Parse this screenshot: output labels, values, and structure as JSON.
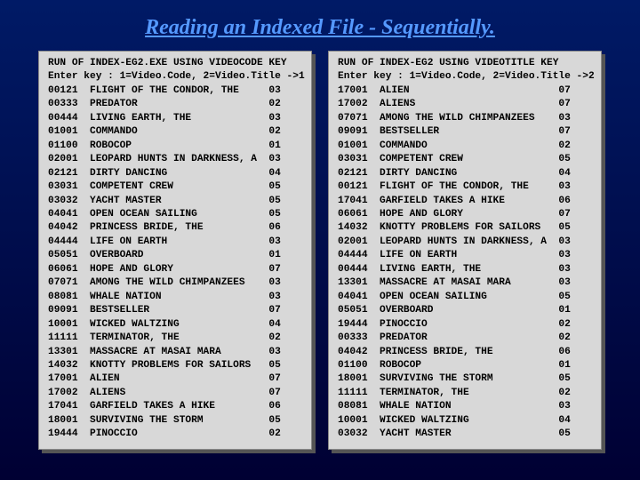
{
  "title": "Reading an Indexed File - Sequentially.",
  "left": {
    "header1": "RUN OF INDEX-EG2.EXE USING VIDEOCODE KEY",
    "header2": "Enter key : 1=Video.Code, 2=Video.Title ->1",
    "rows": [
      {
        "code": "00121",
        "title": "FLIGHT OF THE CONDOR, THE",
        "v": "03"
      },
      {
        "code": "00333",
        "title": "PREDATOR",
        "v": "02"
      },
      {
        "code": "00444",
        "title": "LIVING EARTH, THE",
        "v": "03"
      },
      {
        "code": "01001",
        "title": "COMMANDO",
        "v": "02"
      },
      {
        "code": "01100",
        "title": "ROBOCOP",
        "v": "01"
      },
      {
        "code": "02001",
        "title": "LEOPARD HUNTS IN DARKNESS, A",
        "v": "03"
      },
      {
        "code": "02121",
        "title": "DIRTY DANCING",
        "v": "04"
      },
      {
        "code": "03031",
        "title": "COMPETENT CREW",
        "v": "05"
      },
      {
        "code": "03032",
        "title": "YACHT MASTER",
        "v": "05"
      },
      {
        "code": "04041",
        "title": "OPEN OCEAN SAILING",
        "v": "05"
      },
      {
        "code": "04042",
        "title": "PRINCESS BRIDE, THE",
        "v": "06"
      },
      {
        "code": "04444",
        "title": "LIFE ON EARTH",
        "v": "03"
      },
      {
        "code": "05051",
        "title": "OVERBOARD",
        "v": "01"
      },
      {
        "code": "06061",
        "title": "HOPE AND GLORY",
        "v": "07"
      },
      {
        "code": "07071",
        "title": "AMONG THE WILD CHIMPANZEES",
        "v": "03"
      },
      {
        "code": "08081",
        "title": "WHALE NATION",
        "v": "03"
      },
      {
        "code": "09091",
        "title": "BESTSELLER",
        "v": "07"
      },
      {
        "code": "10001",
        "title": "WICKED WALTZING",
        "v": "04"
      },
      {
        "code": "11111",
        "title": "TERMINATOR, THE",
        "v": "02"
      },
      {
        "code": "13301",
        "title": "MASSACRE AT MASAI MARA",
        "v": "03"
      },
      {
        "code": "14032",
        "title": "KNOTTY PROBLEMS FOR SAILORS",
        "v": "05"
      },
      {
        "code": "17001",
        "title": "ALIEN",
        "v": "07"
      },
      {
        "code": "17002",
        "title": "ALIENS",
        "v": "07"
      },
      {
        "code": "17041",
        "title": "GARFIELD TAKES A HIKE",
        "v": "06"
      },
      {
        "code": "18001",
        "title": "SURVIVING THE STORM",
        "v": "05"
      },
      {
        "code": "19444",
        "title": "PINOCCIO",
        "v": "02"
      }
    ]
  },
  "right": {
    "header1": "RUN OF INDEX-EG2 USING VIDEOTITLE KEY",
    "header2": "Enter key : 1=Video.Code, 2=Video.Title ->2",
    "rows": [
      {
        "code": "17001",
        "title": "ALIEN",
        "v": "07"
      },
      {
        "code": "17002",
        "title": "ALIENS",
        "v": "07"
      },
      {
        "code": "07071",
        "title": "AMONG THE WILD CHIMPANZEES",
        "v": "03"
      },
      {
        "code": "09091",
        "title": "BESTSELLER",
        "v": "07"
      },
      {
        "code": "01001",
        "title": "COMMANDO",
        "v": "02"
      },
      {
        "code": "03031",
        "title": "COMPETENT CREW",
        "v": "05"
      },
      {
        "code": "02121",
        "title": "DIRTY DANCING",
        "v": "04"
      },
      {
        "code": "00121",
        "title": "FLIGHT OF THE CONDOR, THE",
        "v": "03"
      },
      {
        "code": "17041",
        "title": "GARFIELD TAKES A HIKE",
        "v": "06"
      },
      {
        "code": "06061",
        "title": "HOPE AND GLORY",
        "v": "07"
      },
      {
        "code": "14032",
        "title": "KNOTTY PROBLEMS FOR SAILORS",
        "v": "05"
      },
      {
        "code": "02001",
        "title": "LEOPARD HUNTS IN DARKNESS, A",
        "v": "03"
      },
      {
        "code": "04444",
        "title": "LIFE ON EARTH",
        "v": "03"
      },
      {
        "code": "00444",
        "title": "LIVING EARTH, THE",
        "v": "03"
      },
      {
        "code": "13301",
        "title": "MASSACRE AT MASAI MARA",
        "v": "03"
      },
      {
        "code": "04041",
        "title": "OPEN OCEAN SAILING",
        "v": "05"
      },
      {
        "code": "05051",
        "title": "OVERBOARD",
        "v": "01"
      },
      {
        "code": "19444",
        "title": "PINOCCIO",
        "v": "02"
      },
      {
        "code": "00333",
        "title": "PREDATOR",
        "v": "02"
      },
      {
        "code": "04042",
        "title": "PRINCESS BRIDE, THE",
        "v": "06"
      },
      {
        "code": "01100",
        "title": "ROBOCOP",
        "v": "01"
      },
      {
        "code": "18001",
        "title": "SURVIVING THE STORM",
        "v": "05"
      },
      {
        "code": "11111",
        "title": "TERMINATOR, THE",
        "v": "02"
      },
      {
        "code": "08081",
        "title": "WHALE NATION",
        "v": "03"
      },
      {
        "code": "10001",
        "title": "WICKED WALTZING",
        "v": "04"
      },
      {
        "code": "03032",
        "title": "YACHT MASTER",
        "v": "05"
      }
    ]
  }
}
